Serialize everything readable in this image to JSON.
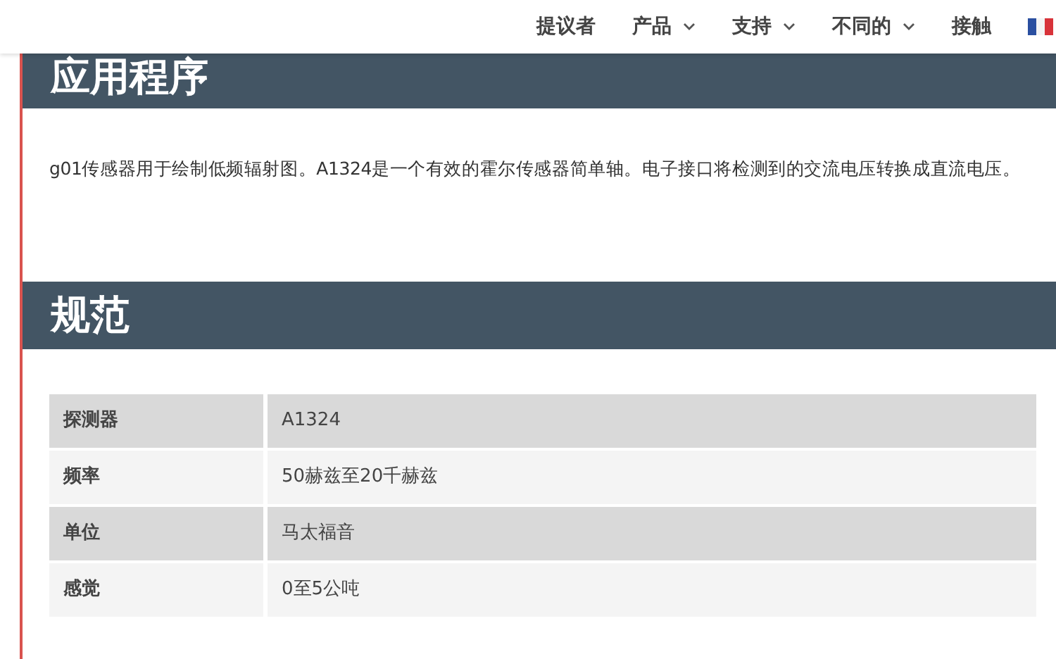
{
  "nav": {
    "items": [
      {
        "label": "提议者",
        "dropdown": false
      },
      {
        "label": "产品",
        "dropdown": true
      },
      {
        "label": "支持",
        "dropdown": true
      },
      {
        "label": "不同的",
        "dropdown": true
      },
      {
        "label": "接触",
        "dropdown": false
      }
    ]
  },
  "sections": [
    {
      "heading": "应用程序",
      "paragraph": "g01传感器用于绘制低频辐射图。A1324是一个有效的霍尔传感器简单轴。电子接口将检测到的交流电压转换成直流电压。"
    },
    {
      "heading": "规范",
      "table": {
        "rows": [
          [
            "探测器",
            "A1324"
          ],
          [
            "频率",
            "50赫兹至20千赫兹"
          ],
          [
            "单位",
            "马太福音"
          ],
          [
            "感觉",
            "0至5公吨"
          ]
        ]
      }
    }
  ]
}
